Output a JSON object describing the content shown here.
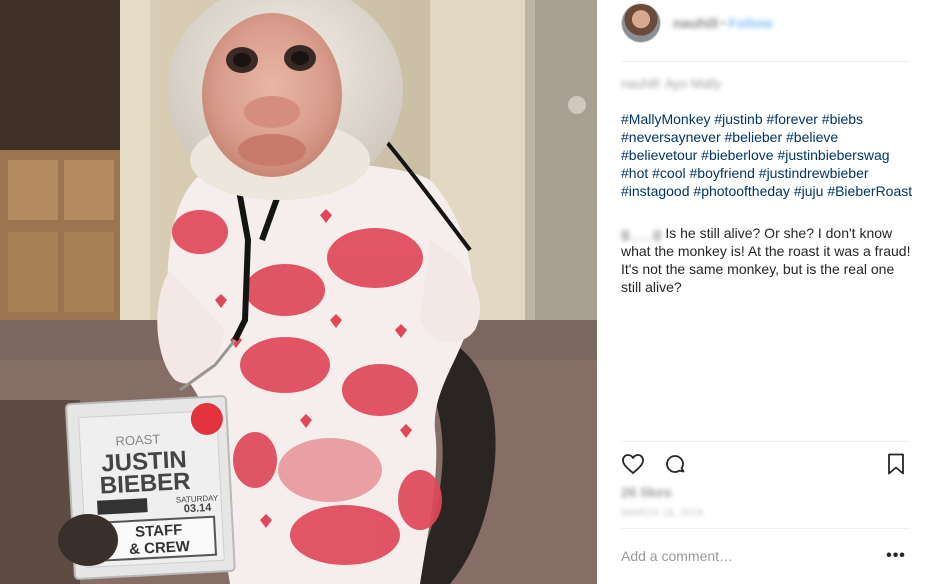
{
  "post": {
    "username": "nauhill",
    "separator": "•",
    "follow_label": "Follow",
    "location": "nauhill: Ayo Mally",
    "hashtags": [
      "#MallyMonkey",
      "#justinb",
      "#forever",
      "#biebs",
      "#neversaynever",
      "#belieber",
      "#believe",
      "#believetour",
      "#bieberlove",
      "#justinbieberswag",
      "#hot",
      "#cool",
      "#boyfriend",
      "#justindrewbieber",
      "#instagood",
      "#photooftheday",
      "#juju",
      "#BieberRoast"
    ],
    "comment": {
      "username": "g___g",
      "text": " Is he still alive? Or she? I don't know what the monkey is! At the roast it was a fraud! It's not the same monkey, but is the real one still alive?"
    },
    "likes": "26 likes",
    "date": "MARCH 18, 2016",
    "comment_placeholder": "Add a comment…",
    "more_label": "•••"
  },
  "photo": {
    "badge_line1": "ROAST",
    "badge_line2": "JUSTIN",
    "badge_line3": "BIEBER",
    "badge_date1": "SATURDAY",
    "badge_date2": "03.14",
    "badge_staff1": "STAFF",
    "badge_staff2": "& CREW"
  },
  "colors": {
    "hashtag": "#003569",
    "follow": "#3897f0",
    "divider": "#efefef"
  },
  "icons": [
    "heart-icon",
    "comment-icon",
    "bookmark-icon",
    "more-options-icon"
  ]
}
